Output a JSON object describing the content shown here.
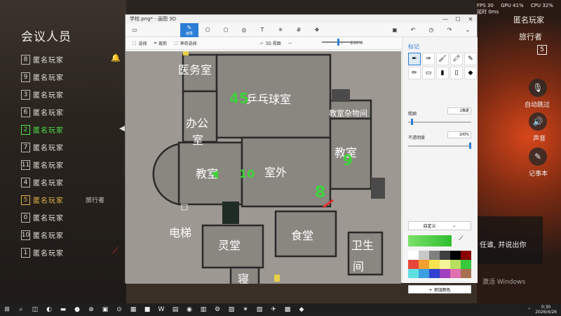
{
  "game": {
    "meeting_title": "会议人员",
    "players": [
      {
        "seat": "8",
        "name": "匿名玩家",
        "style": "normal",
        "role": ""
      },
      {
        "seat": "9",
        "name": "匿名玩家",
        "style": "normal",
        "role": ""
      },
      {
        "seat": "3",
        "name": "匿名玩家",
        "style": "normal",
        "role": ""
      },
      {
        "seat": "6",
        "name": "匿名玩家",
        "style": "normal",
        "role": ""
      },
      {
        "seat": "2",
        "name": "匿名玩家",
        "style": "green",
        "role": ""
      },
      {
        "seat": "7",
        "name": "匿名玩家",
        "style": "normal",
        "role": ""
      },
      {
        "seat": "11",
        "name": "匿名玩家",
        "style": "normal",
        "role": ""
      },
      {
        "seat": "4",
        "name": "匿名玩家",
        "style": "normal",
        "role": ""
      },
      {
        "seat": "5",
        "name": "匿名玩家",
        "style": "gold",
        "role": "旅行者"
      },
      {
        "seat": "0",
        "name": "匿名玩家",
        "style": "normal",
        "role": ""
      },
      {
        "seat": "10",
        "name": "匿名玩家",
        "style": "normal",
        "role": ""
      },
      {
        "seat": "1",
        "name": "匿名玩家",
        "style": "normal",
        "role": ""
      }
    ],
    "self_name": "匿名玩家",
    "self_role": "旅行者",
    "self_seat": "5",
    "right_buttons": [
      {
        "label": "自动跳过",
        "icon": "mic-off-icon"
      },
      {
        "label": "声音",
        "icon": "speaker-icon"
      },
      {
        "label": "记事本",
        "icon": "notepad-icon"
      }
    ],
    "message": "任谁, 并说出你",
    "hud": {
      "fps": "FPS 30",
      "gpu": "GPU 41%",
      "cpu": "CPU 32%",
      "ping": "延时 0ms"
    }
  },
  "paint": {
    "title": "学校.png* - 画图 3D",
    "active_tool": "画笔",
    "toolbar": {
      "select": "选择",
      "crop": "裁剪",
      "magic": "神奇选择",
      "view3d": "3D 视图",
      "zoom": "200%"
    },
    "panel_title": "标记",
    "thickness_label": "粗细",
    "thickness_value": "1像素",
    "opacity_label": "不透明度",
    "opacity_value": "100%",
    "thickness_level": 0.05,
    "opacity_level": 1.0,
    "color_mode": "自定义",
    "current_color": "#4fd64a",
    "add_color": "+ 添加颜色",
    "palette": [
      "#ffffff",
      "#c8c8c8",
      "#808080",
      "#404040",
      "#000000",
      "#8b0000",
      "#e8453c",
      "#f0a030",
      "#f5e350",
      "#f5f59a",
      "#b8e060",
      "#37c83c",
      "#5fe0e0",
      "#3a9fe0",
      "#3040d0",
      "#a040c0",
      "#e070b0",
      "#a87050"
    ],
    "rooms": [
      "医务室",
      "乒乓球室",
      "办公室",
      "教室杂物间",
      "教室",
      "室外",
      "教室",
      "电梯",
      "灵堂",
      "食堂",
      "卫生间",
      "寝"
    ],
    "annotations": [
      "45",
      "10",
      "8",
      "9"
    ]
  },
  "taskbar": {
    "time": "0:30",
    "date": "2026/4/26",
    "windows_watermark": "激活 Windows"
  }
}
